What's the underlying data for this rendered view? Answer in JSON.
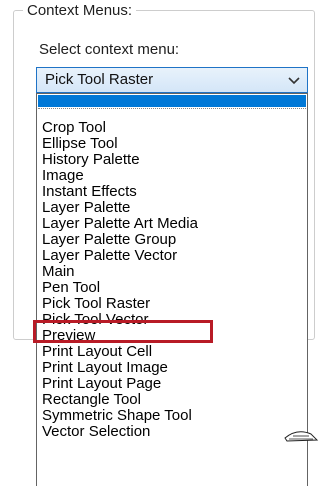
{
  "group": {
    "title": "Context Menus:"
  },
  "select_label": "Select context menu:",
  "combo": {
    "value": "Pick Tool Raster",
    "arrow_icon": "chevron-down-icon"
  },
  "dropdown": {
    "items": [
      "Crop Tool",
      "Ellipse Tool",
      "History Palette",
      "Image",
      "Instant Effects",
      "Layer Palette",
      "Layer Palette Art Media",
      "Layer Palette Group",
      "Layer Palette Vector",
      "Main",
      "Pen Tool",
      "Pick Tool Raster",
      "Pick Tool Vector",
      "Preview",
      "Print Layout Cell",
      "Print Layout Image",
      "Print Layout Page",
      "Rectangle Tool",
      "Symmetric Shape Tool",
      "Vector Selection"
    ]
  },
  "colors": {
    "accent": "#0078d7",
    "highlight_border": "#b81b26"
  }
}
